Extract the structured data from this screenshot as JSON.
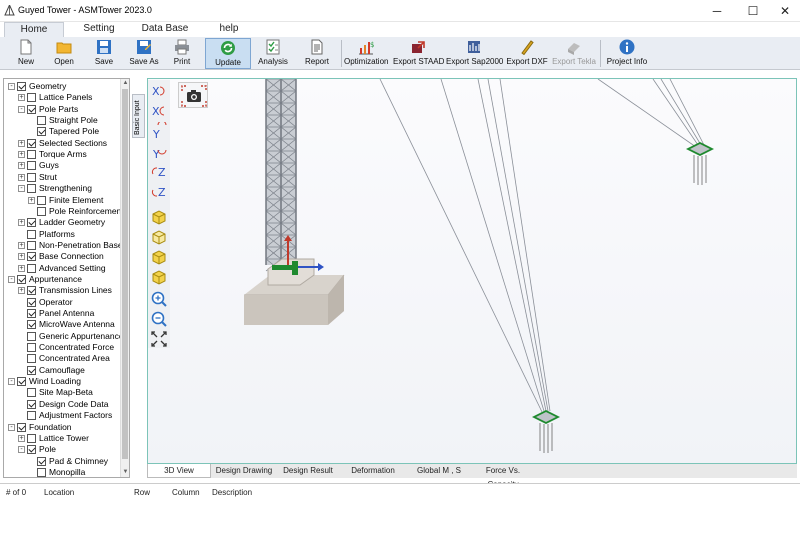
{
  "window": {
    "title": "Guyed Tower - ASMTower 2023.0",
    "minimize": "─",
    "maximize": "☐",
    "close": "✕"
  },
  "ribbon_tabs": [
    "Home",
    "Setting",
    "Data Base",
    "help"
  ],
  "ribbon_buttons": {
    "new": "New",
    "open": "Open",
    "save": "Save",
    "save_as": "Save As",
    "print": "Print",
    "update": "Update",
    "analysis": "Analysis",
    "report": "Report",
    "optimization": "Optimization",
    "export_staad": "Export STAAD",
    "export_sap2000": "Export Sap2000",
    "export_dxf": "Export DXF",
    "export_tekla": "Export Tekla",
    "project_info": "Project Info"
  },
  "side_tab": "Basic Input",
  "tree": [
    {
      "label": "Geometry",
      "level": 0,
      "checked": true,
      "expander": "-"
    },
    {
      "label": "Lattice Panels",
      "level": 1,
      "checked": false,
      "expander": "+"
    },
    {
      "label": "Pole Parts",
      "level": 1,
      "checked": true,
      "expander": "-"
    },
    {
      "label": "Straight Pole",
      "level": 2,
      "checked": false,
      "expander": ""
    },
    {
      "label": "Tapered Pole",
      "level": 2,
      "checked": true,
      "expander": ""
    },
    {
      "label": "Selected Sections",
      "level": 1,
      "checked": true,
      "expander": "+"
    },
    {
      "label": "Torque Arms",
      "level": 1,
      "checked": false,
      "expander": "+"
    },
    {
      "label": "Guys",
      "level": 1,
      "checked": false,
      "expander": "+"
    },
    {
      "label": "Strut",
      "level": 1,
      "checked": false,
      "expander": "+"
    },
    {
      "label": "Strengthening",
      "level": 1,
      "checked": false,
      "expander": "-"
    },
    {
      "label": "Finite Element",
      "level": 2,
      "checked": false,
      "expander": "+"
    },
    {
      "label": "Pole Reinforcement",
      "level": 2,
      "checked": false,
      "expander": ""
    },
    {
      "label": "Ladder Geometry",
      "level": 1,
      "checked": true,
      "expander": "+"
    },
    {
      "label": "Platforms",
      "level": 1,
      "checked": false,
      "expander": ""
    },
    {
      "label": "Non-Penetration Base",
      "level": 1,
      "checked": false,
      "expander": "+"
    },
    {
      "label": "Base Connection",
      "level": 1,
      "checked": true,
      "expander": "+"
    },
    {
      "label": "Advanced Setting",
      "level": 1,
      "checked": false,
      "expander": "+"
    },
    {
      "label": "Appurtenance",
      "level": 0,
      "checked": true,
      "expander": "-"
    },
    {
      "label": "Transmission Lines",
      "level": 1,
      "checked": true,
      "expander": "+"
    },
    {
      "label": "Operator",
      "level": 1,
      "checked": true,
      "expander": ""
    },
    {
      "label": "Panel Antenna",
      "level": 1,
      "checked": true,
      "expander": ""
    },
    {
      "label": "MicroWave Antenna",
      "level": 1,
      "checked": true,
      "expander": ""
    },
    {
      "label": "Generic Appurtenance",
      "level": 1,
      "checked": false,
      "expander": ""
    },
    {
      "label": "Concentrated Force",
      "level": 1,
      "checked": false,
      "expander": ""
    },
    {
      "label": "Concentrated Area",
      "level": 1,
      "checked": false,
      "expander": ""
    },
    {
      "label": "Camouflage",
      "level": 1,
      "checked": true,
      "expander": ""
    },
    {
      "label": "Wind Loading",
      "level": 0,
      "checked": true,
      "expander": "-"
    },
    {
      "label": "Site Map-Beta",
      "level": 1,
      "checked": false,
      "expander": ""
    },
    {
      "label": "Design Code Data",
      "level": 1,
      "checked": true,
      "expander": ""
    },
    {
      "label": "Adjustment Factors",
      "level": 1,
      "checked": false,
      "expander": ""
    },
    {
      "label": "Foundation",
      "level": 0,
      "checked": true,
      "expander": "-"
    },
    {
      "label": "Lattice Tower",
      "level": 1,
      "checked": false,
      "expander": "+"
    },
    {
      "label": "Pole",
      "level": 1,
      "checked": true,
      "expander": "-"
    },
    {
      "label": "Pad & Chimney",
      "level": 2,
      "checked": true,
      "expander": ""
    },
    {
      "label": "Monopilla",
      "level": 2,
      "checked": false,
      "expander": ""
    }
  ],
  "view_toolbar": [
    "rotate-x-plus-icon",
    "rotate-x-minus-icon",
    "rotate-y-plus-icon",
    "rotate-y-minus-icon",
    "rotate-z-plus-icon",
    "rotate-z-minus-icon",
    "view-iso-1-icon",
    "view-iso-2-icon",
    "view-iso-3-icon",
    "view-iso-4-icon",
    "zoom-in-icon",
    "zoom-out-icon",
    "zoom-extents-icon"
  ],
  "bottom_tabs": [
    "3D View",
    "Design Drawing",
    "Design Result",
    "Deformation",
    "Global M , S",
    "Force Vs. Capacity"
  ],
  "messages": {
    "cols": [
      "# of 0",
      "Location",
      "Row",
      "Column",
      "Description"
    ]
  },
  "colors": {
    "accent": "#2f72c4",
    "ribbon_bg": "#e9edf3",
    "viewport_border": "#7cc4b8",
    "plate_green": "#1f8a2f"
  }
}
